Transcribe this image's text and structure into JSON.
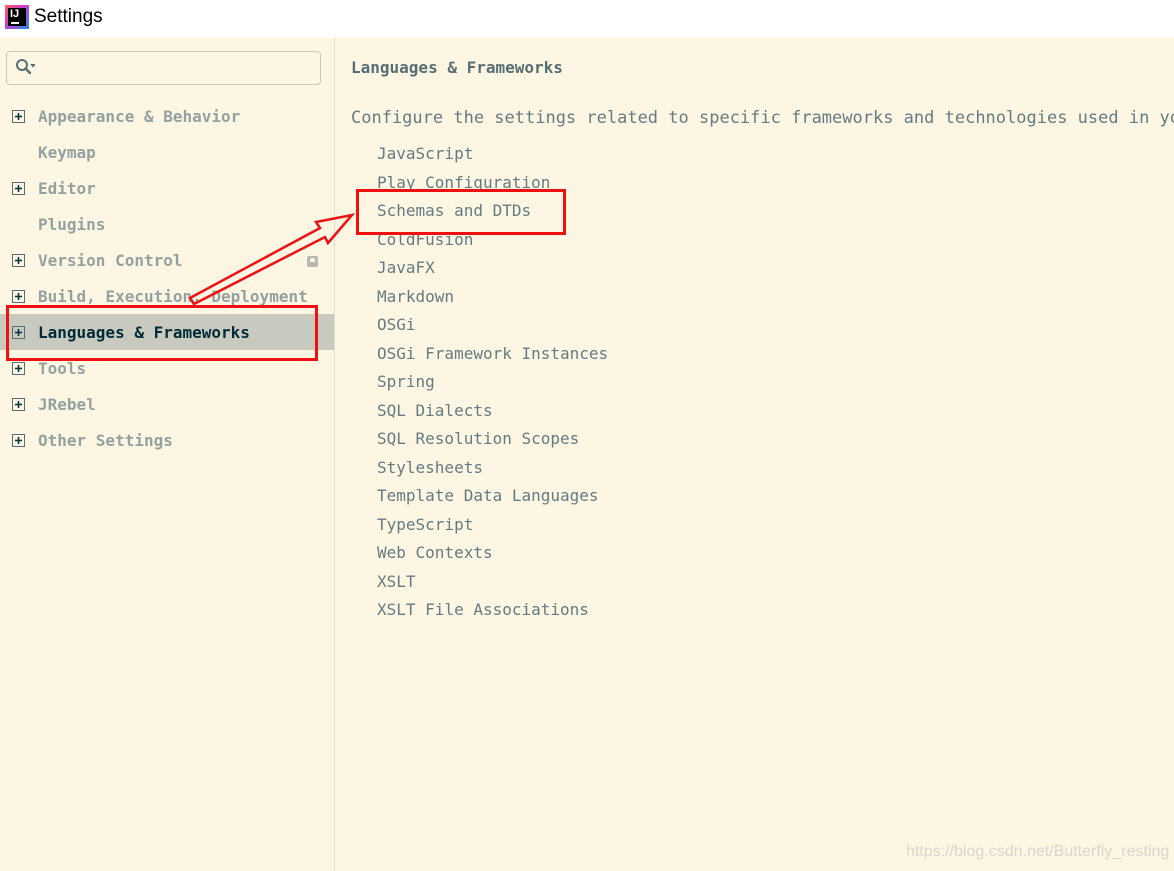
{
  "window": {
    "title": "Settings",
    "app_icon": "intellij-idea-icon"
  },
  "search": {
    "placeholder": "",
    "icon": "search-icon"
  },
  "sidebar": {
    "items": [
      {
        "label": "Appearance & Behavior",
        "expandable": true,
        "selected": false
      },
      {
        "label": "Keymap",
        "expandable": false,
        "selected": false
      },
      {
        "label": "Editor",
        "expandable": true,
        "selected": false
      },
      {
        "label": "Plugins",
        "expandable": false,
        "selected": false
      },
      {
        "label": "Version Control",
        "expandable": true,
        "selected": false,
        "badge_icon": "project-level-icon"
      },
      {
        "label": "Build, Execution, Deployment",
        "expandable": true,
        "selected": false
      },
      {
        "label": "Languages & Frameworks",
        "expandable": true,
        "selected": true
      },
      {
        "label": "Tools",
        "expandable": true,
        "selected": false
      },
      {
        "label": "JRebel",
        "expandable": true,
        "selected": false
      },
      {
        "label": "Other Settings",
        "expandable": true,
        "selected": false
      }
    ]
  },
  "main": {
    "heading": "Languages & Frameworks",
    "description": "Configure the settings related to specific frameworks and technologies used in your",
    "links": [
      "JavaScript",
      "Play Configuration",
      "Schemas and DTDs",
      "ColdFusion",
      "JavaFX",
      "Markdown",
      "OSGi",
      "OSGi Framework Instances",
      "Spring",
      "SQL Dialects",
      "SQL Resolution Scopes",
      "Stylesheets",
      "Template Data Languages",
      "TypeScript",
      "Web Contexts",
      "XSLT",
      "XSLT File Associations"
    ]
  },
  "annotation": {
    "color": "#ee1111",
    "highlighted_sidebar": "Languages & Frameworks",
    "highlighted_link": "Schemas and DTDs"
  },
  "watermark": "https://blog.csdn.net/Butterfly_resting",
  "colors": {
    "background": "#fdf6e3",
    "selected_row": "#c8c9bf",
    "sidebar_text": "#93a1a1",
    "content_text": "#657b83"
  }
}
